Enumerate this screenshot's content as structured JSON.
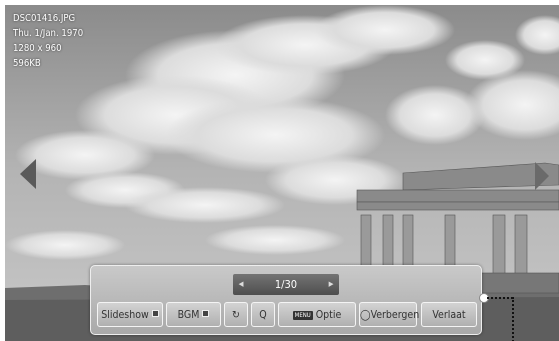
{
  "file_info": {
    "filename": "DSC01416.JPG",
    "date": "Thu. 1/Jan. 1970",
    "resolution": "1280 x 960",
    "size": "596KB"
  },
  "pager": {
    "label": "1/30"
  },
  "controls": {
    "slideshow": "Slideshow",
    "bgm": "BGM",
    "menu_key": "MENU",
    "option": "Optie",
    "hide": "Verbergen",
    "exit": "Verlaat"
  },
  "icons": {
    "rotate": "↻",
    "zoom": "Q"
  }
}
